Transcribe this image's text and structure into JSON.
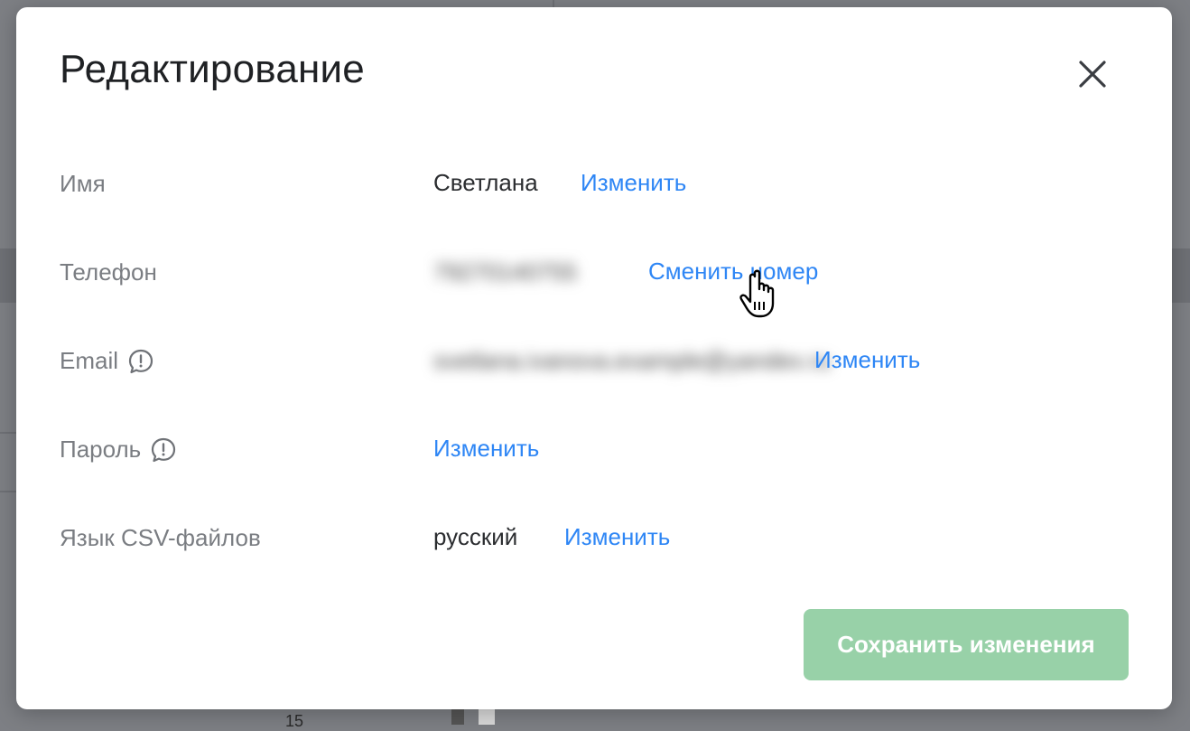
{
  "modal": {
    "title": "Редактирование",
    "close_icon": "close-icon",
    "fields": {
      "name": {
        "label": "Имя",
        "value": "Светлана",
        "action": "Изменить"
      },
      "phone": {
        "label": "Телефон",
        "value": "79270140755",
        "action": "Сменить номер"
      },
      "email": {
        "label": "Email",
        "value": "svetlana.ivanova.example@yandex.ru",
        "action": "Изменить",
        "icon": "info-message-icon"
      },
      "password": {
        "label": "Пароль",
        "action": "Изменить",
        "icon": "info-message-icon"
      },
      "csv_language": {
        "label": "Язык CSV-файлов",
        "value": "русский",
        "action": "Изменить"
      }
    },
    "save_label": "Сохранить изменения"
  },
  "background": {
    "partial_number": "15"
  },
  "colors": {
    "link": "#2e86f5",
    "save_button_disabled": "#98d1a8",
    "label": "#7a7d82",
    "overlay": "#7d7f84"
  },
  "cursor": "hand-pointer-icon"
}
